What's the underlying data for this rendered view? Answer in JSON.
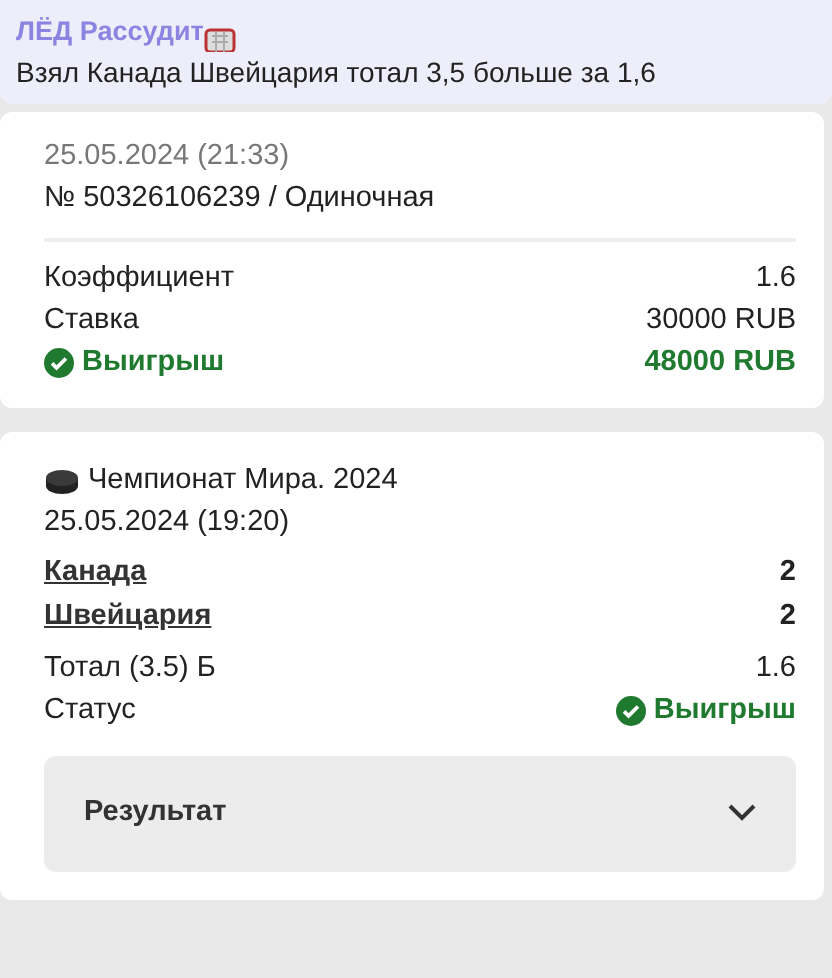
{
  "message": {
    "author": "ЛЁД Рассудит",
    "text": "Взял Канада Швейцария тотал 3,5 больше за 1,6"
  },
  "bet": {
    "date": "25.05.2024 (21:33)",
    "number": "№ 50326106239 / Одиночная",
    "rows": [
      {
        "label": "Коэффициент",
        "value": "1.6",
        "kind": "plain"
      },
      {
        "label": "Ставка",
        "value": "30000 RUB",
        "kind": "plain"
      },
      {
        "label": "Выигрыш",
        "value": "48000 RUB",
        "kind": "win"
      }
    ]
  },
  "event": {
    "league": "Чемпионат Мира. 2024",
    "date": "25.05.2024 (19:20)",
    "teams": [
      {
        "name": "Канада",
        "score": "2"
      },
      {
        "name": "Швейцария",
        "score": "2"
      }
    ],
    "rows": [
      {
        "label": "Тотал (3.5) Б",
        "value": "1.6",
        "kind": "plain"
      },
      {
        "label": "Статус",
        "value": "Выигрыш",
        "kind": "win"
      }
    ],
    "result": {
      "label": "Результат",
      "expanded": false
    }
  }
}
